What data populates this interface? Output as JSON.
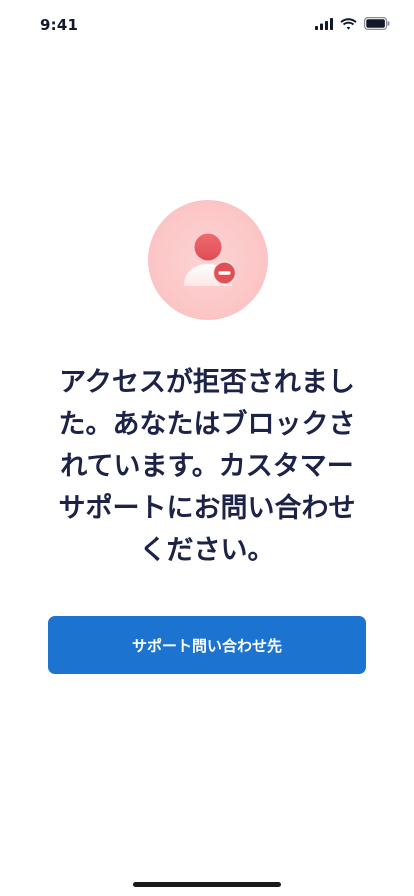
{
  "status_bar": {
    "time": "9:41",
    "icons": [
      "cellular-signal-icon",
      "wifi-icon",
      "battery-icon"
    ]
  },
  "illustration": {
    "icon": "user-blocked-icon",
    "accent_color": "#e8585e",
    "background_color": "#fcc8c8"
  },
  "message": {
    "text": "アクセスが拒否されました。あなたはブロックされています。カスタマー サポートにお問い合わせください。"
  },
  "contact_button": {
    "label": "サポート問い合わせ先",
    "color": "#1d74d0"
  }
}
